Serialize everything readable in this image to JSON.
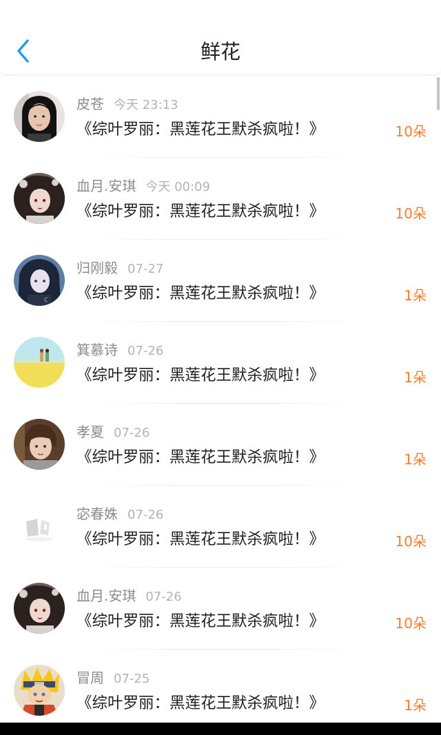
{
  "header": {
    "title": "鲜花",
    "accent_color": "#1a9cff"
  },
  "flowers": [
    {
      "name": "皮苍",
      "time": "今天 23:13",
      "book": "《综叶罗丽：黑莲花王默杀疯啦！》",
      "count": "10朵",
      "avatar": "girl-photo"
    },
    {
      "name": "血月.安琪",
      "time": "今天 00:09",
      "book": "《综叶罗丽：黑莲花王默杀疯啦！》",
      "count": "10朵",
      "avatar": "anime-girl-dark"
    },
    {
      "name": "归刚毅",
      "time": "07-27",
      "book": "《综叶罗丽：黑莲花王默杀疯啦！》",
      "count": "1朵",
      "avatar": "anime-girl-blue"
    },
    {
      "name": "箕慕诗",
      "time": "07-26",
      "book": "《综叶罗丽：黑莲花王默杀疯啦！》",
      "count": "1朵",
      "avatar": "field-illustration"
    },
    {
      "name": "孝夏",
      "time": "07-26",
      "book": "《综叶罗丽：黑莲花王默杀疯啦！》",
      "count": "1朵",
      "avatar": "boy-photo"
    },
    {
      "name": "宓春姝",
      "time": "07-26",
      "book": "《综叶罗丽：黑莲花王默杀疯啦！》",
      "count": "10朵",
      "avatar": "faded-image"
    },
    {
      "name": "血月.安琪",
      "time": "07-26",
      "book": "《综叶罗丽：黑莲花王默杀疯啦！》",
      "count": "10朵",
      "avatar": "anime-girl-dark"
    },
    {
      "name": "冒周",
      "time": "07-25",
      "book": "《综叶罗丽：黑莲花王默杀疯啦！》",
      "count": "1朵",
      "avatar": "naruto-character"
    }
  ]
}
